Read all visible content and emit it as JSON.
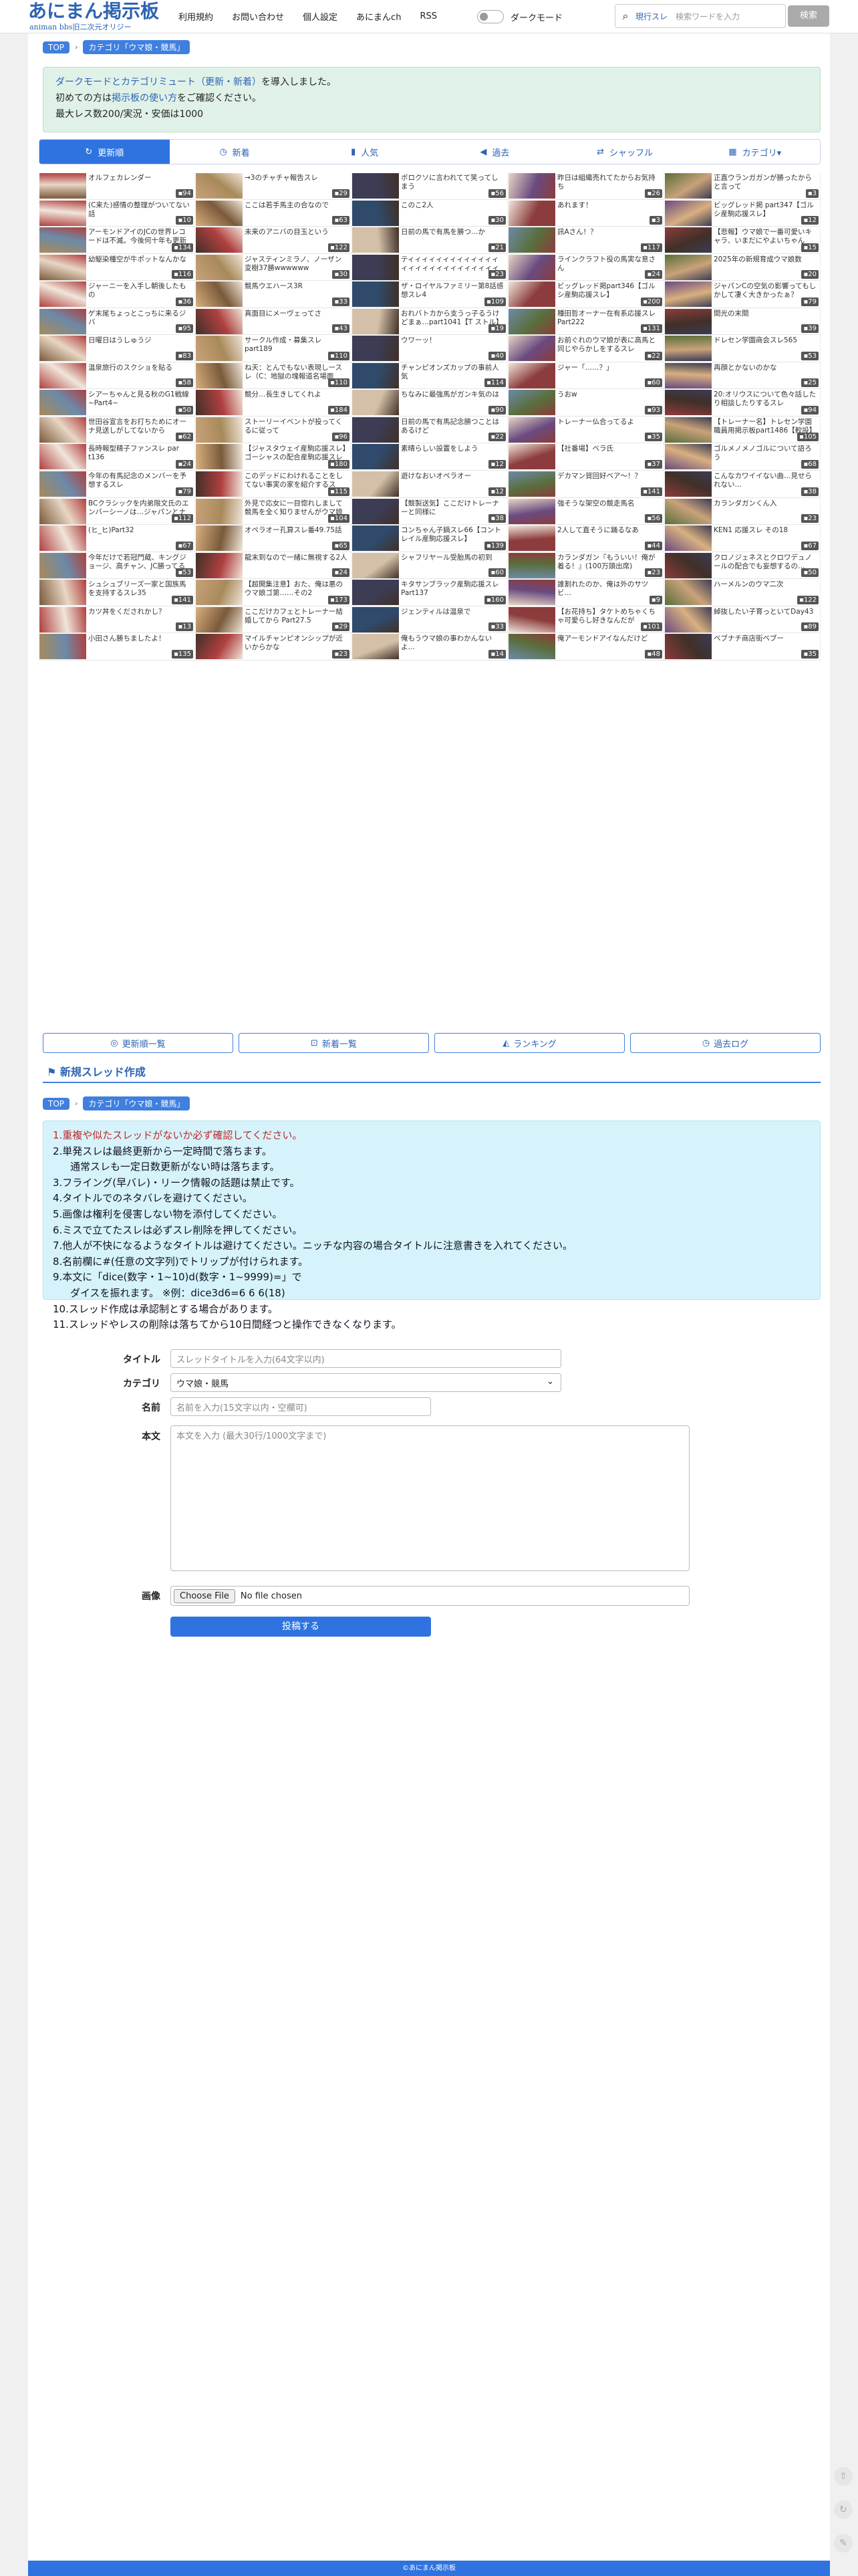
{
  "header": {
    "logo_main": "あにまん掲示板",
    "logo_sub": "animan bbs旧二次元オリジー",
    "nav": [
      "利用規約",
      "お問い合わせ",
      "個人設定",
      "あにまんch",
      "RSS"
    ],
    "darkmode_label": "ダークモード",
    "search_select": "現行スレ",
    "search_placeholder": "検索ワードを入力",
    "search_button": "検索"
  },
  "breadcrumb": {
    "top": "TOP",
    "category": "カテゴリ「ウマ娘・競馬」"
  },
  "notice": {
    "line1_link": "ダークモードとカテゴリミュート（更新・新着）",
    "line1_rest": "を導入しました。",
    "line2_pre": "初めての方は",
    "line2_link": "掲示板の使い方",
    "line2_post": "をご確認ください。",
    "line3": "最大レス数200/実況・安価は1000"
  },
  "tabs": [
    {
      "icon": "↻",
      "label": "更新順"
    },
    {
      "icon": "◷",
      "label": "新着"
    },
    {
      "icon": "▮",
      "label": "人気"
    },
    {
      "icon": "◀",
      "label": "過去"
    },
    {
      "icon": "⇄",
      "label": "シャッフル"
    },
    {
      "icon": "▦",
      "label": "カテゴリ▾"
    }
  ],
  "threads": [
    {
      "t": "オルフェカレンダー",
      "c": "94"
    },
    {
      "t": "→3のチャチャ報告スレ",
      "c": "29"
    },
    {
      "t": "ボロクソに言われてて笑ってしまう",
      "c": "56"
    },
    {
      "t": "昨日は組織売れてたからお気持ち",
      "c": "26"
    },
    {
      "t": "正直ウランガガンが勝ったからと言って",
      "c": "3"
    },
    {
      "t": "(C来た)感情の整理がついてない話",
      "c": "10"
    },
    {
      "t": "ここは若手馬主の合なので",
      "c": "63"
    },
    {
      "t": "このこ2人",
      "c": "30"
    },
    {
      "t": "あれます！",
      "c": "3"
    },
    {
      "t": "ビッグレッド掲 part347【ゴルシ産駒応援スレ】",
      "c": "12"
    },
    {
      "t": "アーモンドアイのJCの世界レコードは不滅。今後何十年も更新されないだろう",
      "c": "134"
    },
    {
      "t": "未来のアニバの目玉という",
      "c": "122"
    },
    {
      "t": "日前の馬で有馬を勝つ…か",
      "c": "21"
    },
    {
      "t": "訊Aさん！？",
      "c": "117"
    },
    {
      "t": "【悲報】ウマ娘で一番可愛いキャラ、いまだにやよいちゃん",
      "c": "15"
    },
    {
      "t": "幼駆染種空が牛ポットなんかな",
      "c": "116"
    },
    {
      "t": "ジャスティンミラノ、ノーザン変樹37勝wwwwww",
      "c": "30"
    },
    {
      "t": "ティィィィィィィィィィィィィィィィィィィィィィィィィィィィィィィィィ",
      "c": "23"
    },
    {
      "t": "ラインクラフト役の馬実な意さん",
      "c": "24"
    },
    {
      "t": "2025年の新規育成ウマ娘数",
      "c": "20"
    },
    {
      "t": "ジャーニーを入手し朝後したもの",
      "c": "36"
    },
    {
      "t": "競馬ウエハース3R",
      "c": "33"
    },
    {
      "t": "ザ・ロイヤルファミリー第8話感想スレ4",
      "c": "109"
    },
    {
      "t": "ビッグレッド掲part346【ゴルシ産駒応援スレ】",
      "c": "200"
    },
    {
      "t": "ジャパンCの空気の影響ってもしかして凄く大きかったぁ？",
      "c": "79"
    },
    {
      "t": "ゲ末尾ちょっとこっちに来るジバ",
      "c": "95"
    },
    {
      "t": "真面目にメーヴェってさ",
      "c": "43"
    },
    {
      "t": "おれバトカから支うっ子るうけどまぁ…part1041【T ストル】",
      "c": "19"
    },
    {
      "t": "種田哲オーナー在有系応援スレ Part222",
      "c": "131"
    },
    {
      "t": "間光の末間",
      "c": "39"
    },
    {
      "t": "日曜日はうしゅうジ",
      "c": "83"
    },
    {
      "t": "サークル作成・募集スレ part189",
      "c": "110"
    },
    {
      "t": "ウワーッ！",
      "c": "40"
    },
    {
      "t": "お前ぐれのウマ娘が表に高馬と同じやらかしをするスレ",
      "c": "22"
    },
    {
      "t": "ドレセン学園商会スレ565",
      "c": "53"
    },
    {
      "t": "温泉旅行のスクショを貼る",
      "c": "58"
    },
    {
      "t": "ね天：とんでもない表現しースレ（C：地獄の塊報道名場面",
      "c": "110"
    },
    {
      "t": "チャンピオンズカップの事前人気",
      "c": "114"
    },
    {
      "t": "ジャー「……？」",
      "c": "60"
    },
    {
      "t": "再顔とかないのかな",
      "c": "25"
    },
    {
      "t": "シアーちゃんと見る秋のG1戦線 ~Part4~",
      "c": "50"
    },
    {
      "t": "競分…長生きしてくれよ",
      "c": "184"
    },
    {
      "t": "ちなみに最強馬がガンキ気のは",
      "c": "90"
    },
    {
      "t": "うおw",
      "c": "93"
    },
    {
      "t": "20:オリウスについて色々話したり相談したりするスレ",
      "c": "94"
    },
    {
      "t": "世田谷宣言をお打ちためにオーナ見送しがしてないから",
      "c": "62"
    },
    {
      "t": "ストーリーイベントが投ってくるに従って",
      "c": "96"
    },
    {
      "t": "日前の馬で有馬記念勝つことはあるけど",
      "c": "22"
    },
    {
      "t": "トレーナー仏合ってるよ",
      "c": "35"
    },
    {
      "t": "【トレーナー名】トレセン学園職員用掲示板part1486【較設】",
      "c": "105"
    },
    {
      "t": "長時報型精子ファンスレ par t136",
      "c": "24"
    },
    {
      "t": "【ジャスタウェイ産駒応援スレ】ゴーシャスの配合産駒応援スレ",
      "c": "180"
    },
    {
      "t": "素晴らしい設置をしよう",
      "c": "12"
    },
    {
      "t": "【社番場】ベラ氏",
      "c": "37"
    },
    {
      "t": "ゴルメノメノゴルについて語ろう",
      "c": "68"
    },
    {
      "t": "今年の有馬記念のメンバーを予想するスレ",
      "c": "79"
    },
    {
      "t": "このデッドにわけれることをしてない事実の家を紹介するスレ？",
      "c": "115"
    },
    {
      "t": "遊けなおいオペラオー",
      "c": "12"
    },
    {
      "t": "デカマン貿回好ベア〜！？",
      "c": "141"
    },
    {
      "t": "こんなカワイイない曲…見せられない…",
      "c": "38"
    },
    {
      "t": "BCクラシックを内弟限文氏のエンバーシーノは…ジャパンとナヨクラン系のカランダガンが勝ったが",
      "c": "112"
    },
    {
      "t": "外見で応女に一目惚れしまして競馬を全く知りませんがウマ娘始めます",
      "c": "104"
    },
    {
      "t": "【競製送気】ここだけトレーナーと同様に",
      "c": "38"
    },
    {
      "t": "強そうな架空の競走馬名",
      "c": "56"
    },
    {
      "t": "カランダガンくん入",
      "c": "23"
    },
    {
      "t": "(ヒ_ヒ)Part32",
      "c": "67"
    },
    {
      "t": "オペラオー孔算スレ番49.75話",
      "c": "65"
    },
    {
      "t": "コンちゃん子鍋スレ66【コントレイル産駒応援スレ】",
      "c": "139"
    },
    {
      "t": "2人して直そうに踊るなあ",
      "c": "44"
    },
    {
      "t": "KEN1 応援スレ その18",
      "c": "67"
    },
    {
      "t": "今年だけで若冠門蔵、キングジョージ、高チャン、JC勝ってるのヤバいよな",
      "c": "53"
    },
    {
      "t": "龍末到なので一緒に無視する2人",
      "c": "24"
    },
    {
      "t": "シャフリヤール受胎馬の初到",
      "c": "60"
    },
    {
      "t": "カランダガン『もういい！俺が着る！』(100万頭出席)",
      "c": "23"
    },
    {
      "t": "クロノジェネスとクロワデュノールの配合でも妄想するの…",
      "c": "50"
    },
    {
      "t": "シュシュブリーズ一家と国族馬を支持するスレ35",
      "c": "141"
    },
    {
      "t": "【超開集注意】おた、俺は悪のウマ娘ゴ第……その2",
      "c": "173"
    },
    {
      "t": "キタサンブラック産駒応援スレ Part137",
      "c": "160"
    },
    {
      "t": "誰割れたのか、俺は外のサツビ…",
      "c": "9"
    },
    {
      "t": "ハーメルンのウマ二次",
      "c": "122"
    },
    {
      "t": "カツ丼をくだされかし？",
      "c": "13"
    },
    {
      "t": "ここだけカフェとトレーナー結婚してから Part27.5",
      "c": "29"
    },
    {
      "t": "ジェンティルは温泉で",
      "c": "33"
    },
    {
      "t": "【お花持ち】タケトめちゃくちゃ可愛らし好きなんだが",
      "c": "101"
    },
    {
      "t": "綽抜したい子育っといてDay43",
      "c": "89"
    },
    {
      "t": "小田さん勝ちましたよ！",
      "c": "135"
    },
    {
      "t": "マイルチャンピオンシップが近いからかな",
      "c": "23"
    },
    {
      "t": "俺もうウマ娘の事わかんないよ…",
      "c": "14"
    },
    {
      "t": "俺アーモンドアイなんだけど",
      "c": "48"
    },
    {
      "t": "ベブナチ商店街ベブー",
      "c": "35"
    }
  ],
  "thumb_colors": [
    "#7a5a3a",
    "#c9a27a",
    "#3c3c54",
    "#e8d6c4",
    "#5a6e3c",
    "#b04040",
    "#d8b080",
    "#2f4a6a",
    "#f0e6da",
    "#6a4a80",
    "#a88a5a",
    "#403028",
    "#d4c0a8",
    "#6c8aa8",
    "#8c3c3c"
  ],
  "footer_nav": [
    {
      "icon": "◎",
      "label": "更新順一覧"
    },
    {
      "icon": "⊡",
      "label": "新着一覧"
    },
    {
      "icon": "◭",
      "label": "ランキング"
    },
    {
      "icon": "◷",
      "label": "過去ログ"
    }
  ],
  "create_title": "新規スレッド作成",
  "rules": [
    "1.重複や似たスレッドがないか必ず確認してください。",
    "2.単発スレは最終更新から一定時間で落ちます。",
    "通常スレも一定日数更新がない時は落ちます。",
    "3.フライング(早バレ)・リーク情報の話題は禁止です。",
    "4.タイトルでのネタバレを避けてください。",
    "5.画像は権利を侵害しない物を添付してください。",
    "6.ミスで立てたスレは必ずスレ削除を押してください。",
    "7.他人が不快になるようなタイトルは避けてください。ニッチな内容の場合タイトルに注意書きを入れてください。",
    "8.名前欄に#(任意の文字列)でトリップが付けられます。",
    "9.本文に「dice(数字・1~10)d(数字・1~9999)=」で",
    "ダイスを振れます。 ※例：dice3d6=6 6 6(18)",
    "10.スレッド作成は承認制とする場合があります。",
    "11.スレッドやレスの削除は落ちてから10日間経つと操作できなくなります。"
  ],
  "form": {
    "title_label": "タイトル",
    "title_placeholder": "スレッドタイトルを入力(64文字以内)",
    "category_label": "カテゴリ",
    "category_value": "ウマ娘・競馬",
    "name_label": "名前",
    "name_placeholder": "名前を入力(15文字以内・空欄可)",
    "body_label": "本文",
    "body_placeholder": "本文を入力 (最大30行/1000文字まで)",
    "image_label": "画像",
    "file_button": "Choose File",
    "file_status": "No file chosen",
    "submit": "投稿する"
  },
  "footer": "©あにまん掲示板"
}
